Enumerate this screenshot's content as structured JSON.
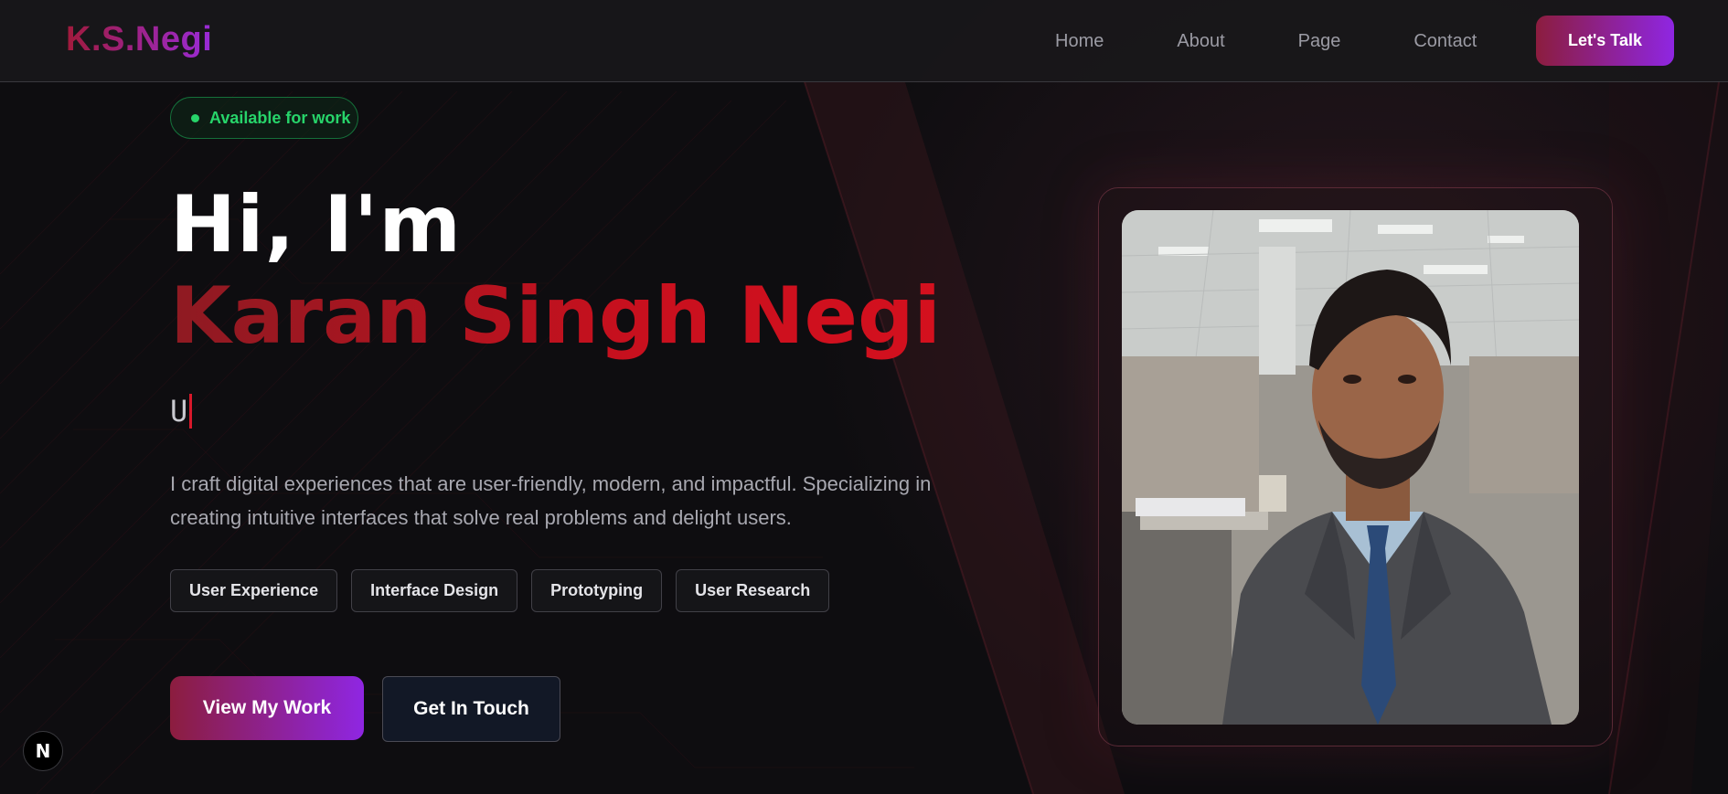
{
  "brand": {
    "logo": "K.S.Negi"
  },
  "nav": {
    "links": [
      "Home",
      "About",
      "Page",
      "Contact"
    ],
    "cta_label": "Let's Talk"
  },
  "hero": {
    "badge": "Available for work",
    "greeting": "Hi, I'm",
    "name": "Karan Singh Negi",
    "typed_text": "U",
    "description": "I craft digital experiences that are user-friendly, modern, and impactful. Specializing in creating intuitive interfaces that solve real problems and delight users.",
    "skills": [
      "User Experience",
      "Interface Design",
      "Prototyping",
      "User Research"
    ],
    "primary_button": "View My Work",
    "secondary_button": "Get In Touch"
  },
  "dev_badge": {
    "label": "N"
  },
  "colors": {
    "background": "#0e0d10",
    "accent_gradient_start": "#8c1d3e",
    "accent_gradient_end": "#8f26e2",
    "name_red": "#c8101e",
    "available_green": "#27d46a"
  },
  "icons": [
    "status-dot-icon",
    "nextjs-icon"
  ]
}
